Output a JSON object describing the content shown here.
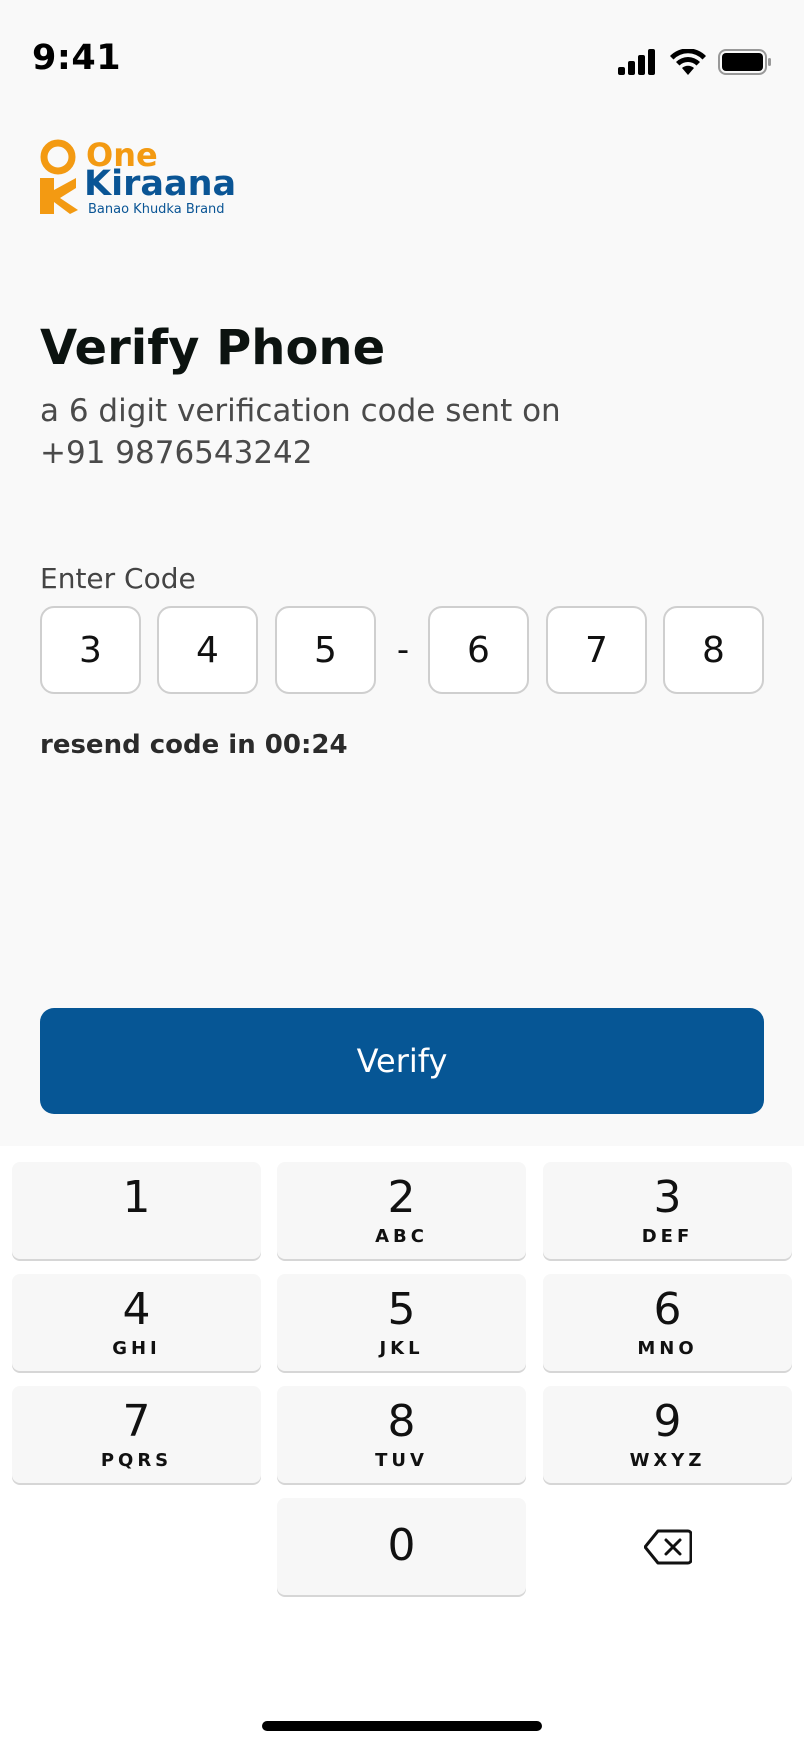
{
  "status_bar": {
    "time": "9:41",
    "icons": [
      "signal-icon",
      "wifi-icon",
      "battery-icon"
    ]
  },
  "logo": {
    "word1": "One",
    "word2": "Kiraana",
    "tagline": "Banao Khudka Brand",
    "colors": {
      "orange": "#f39a12",
      "blue": "#0a5595"
    }
  },
  "header": {
    "title": "Verify Phone",
    "subtitle_line1": "a 6 digit verification code sent on",
    "subtitle_line2": "+91 9876543242"
  },
  "code": {
    "label": "Enter Code",
    "digits": [
      "3",
      "4",
      "5",
      "6",
      "7",
      "8"
    ],
    "separator": "-"
  },
  "resend": {
    "text": "resend code in 00:24"
  },
  "verify_button": {
    "label": "Verify",
    "color": "#065695"
  },
  "keypad": {
    "keys": [
      {
        "digit": "1",
        "letters": ""
      },
      {
        "digit": "2",
        "letters": "ABC"
      },
      {
        "digit": "3",
        "letters": "DEF"
      },
      {
        "digit": "4",
        "letters": "GHI"
      },
      {
        "digit": "5",
        "letters": "JKL"
      },
      {
        "digit": "6",
        "letters": "MNO"
      },
      {
        "digit": "7",
        "letters": "PQRS"
      },
      {
        "digit": "8",
        "letters": "TUV"
      },
      {
        "digit": "9",
        "letters": "WXYZ"
      },
      {
        "digit": "0",
        "letters": ""
      }
    ],
    "backspace_icon": "backspace-icon"
  }
}
